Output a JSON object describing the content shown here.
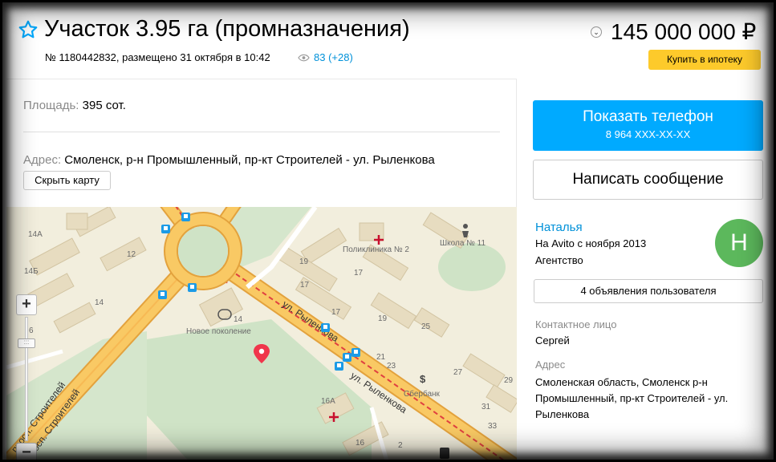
{
  "listing": {
    "title": "Участок 3.95 га (промназначения)",
    "meta": "№ 1180442832, размещено 31 октября в 10:42",
    "views": "83 (+28)",
    "price": "145 000 000 ₽",
    "mortgage_label": "Купить в ипотеку"
  },
  "details": {
    "area_label": "Площадь:",
    "area_value": "395 сот.",
    "address_label": "Адрес:",
    "address_value": "Смоленск, р-н Промышленный, пр-кт Строителей - ул. Рыленкова",
    "hide_map_label": "Скрыть карту"
  },
  "map": {
    "labels": {
      "b14a": "14А",
      "b14b": "14Б",
      "b12": "12",
      "b14": "14",
      "b6": "6",
      "b14c": "14",
      "novoe": "Новое поколение",
      "b19a": "19",
      "b17a": "17",
      "b19b": "19",
      "b17b": "17",
      "poly": "Поликлиника № 2",
      "school": "Школа № 11",
      "b25": "25",
      "b21": "21",
      "b23": "23",
      "b27": "27",
      "b29": "29",
      "b31": "31",
      "b33": "33",
      "b16a": "16А",
      "b16": "16",
      "b2": "2",
      "sber": "Сбербанк",
      "street_stroit1": "просп. Строителей",
      "street_stroit2": "просп. Строителей",
      "street_rylenkova1": "ул. Рыленкова",
      "street_rylenkova2": "ул. Рыленкова"
    },
    "zoom_in": "+",
    "zoom_out": "−",
    "zoom_handle": ":::"
  },
  "seller": {
    "phone_label": "Показать телефон",
    "phone_number": "8 964 XXX-XX-XX",
    "message_label": "Написать сообщение",
    "name": "Наталья",
    "since": "На Avito с ноября 2013",
    "type": "Агентство",
    "avatar_letter": "Н",
    "ads_count_label": "4 объявления пользователя",
    "contact_label": "Контактное лицо",
    "contact_value": "Сергей",
    "address_label": "Адрес",
    "address_value": "Смоленская область, Смоленск р-н Промышленный, пр-кт Строителей - ул. Рыленкова"
  },
  "colors": {
    "accent_blue": "#00aaff",
    "link_blue": "#0091d9",
    "mortgage_yellow": "#fdca2b",
    "avatar_green": "#5cb85c",
    "map_bg": "#f2eedd",
    "map_green": "#cfe3c6",
    "road_orange": "#f7b954",
    "road_yellow": "#fde28a"
  },
  "icons": {
    "favorite": "star-outline-icon",
    "views": "eye-icon",
    "price_dropdown": "chevron-down-icon",
    "map_pin": "map-pin-icon",
    "bus_stop": "bus-stop-icon",
    "hospital": "hospital-cross-icon",
    "school": "school-icon",
    "bank": "dollar-icon",
    "metro": "transit-icon"
  }
}
